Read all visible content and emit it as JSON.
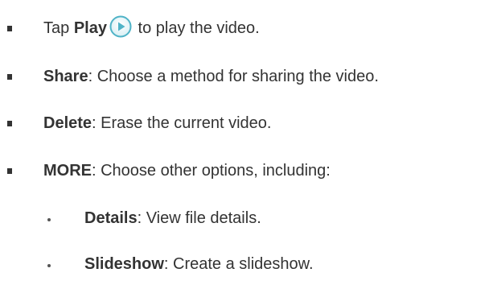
{
  "items": [
    {
      "level": 1,
      "pre": "Tap ",
      "bold": "Play",
      "post": " to play the video.",
      "icon": "play-circle-icon"
    },
    {
      "level": 1,
      "bold": "Share",
      "post": ": Choose a method for sharing the video."
    },
    {
      "level": 1,
      "bold": "Delete",
      "post": ": Erase the current video."
    },
    {
      "level": 1,
      "bold": "MORE",
      "post": ": Choose other options, including:"
    },
    {
      "level": 2,
      "bold": "Details",
      "post": ": View file details."
    },
    {
      "level": 2,
      "bold": "Slideshow",
      "post": ": Create a slideshow."
    }
  ],
  "colors": {
    "text": "#333333",
    "icon_fill": "#4fb3c7"
  }
}
